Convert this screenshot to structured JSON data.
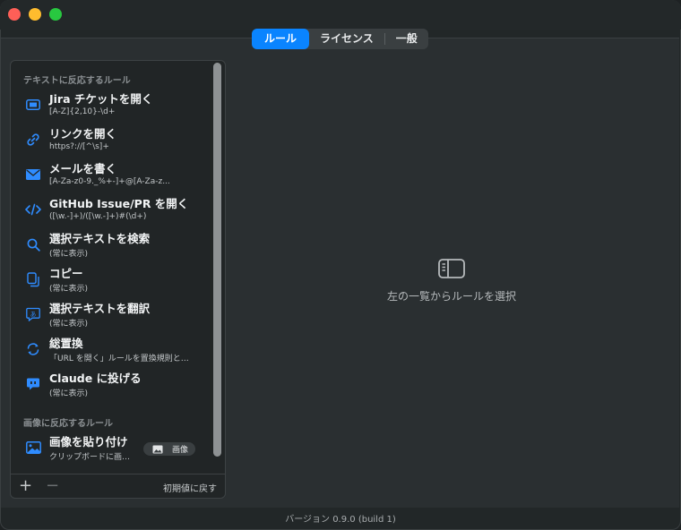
{
  "window": {
    "traffic_lights": [
      "close",
      "minimize",
      "maximize"
    ]
  },
  "tabs": [
    {
      "label": "ルール",
      "active": true
    },
    {
      "label": "ライセンス",
      "active": false
    },
    {
      "label": "一般",
      "active": false
    }
  ],
  "sidebar": {
    "text_section_header": "テキストに反応するルール",
    "image_section_header": "画像に反応するルール",
    "text_rules": [
      {
        "title": "Jira チケットを開く",
        "subtitle": "[A-Z]{2,10}-\\d+",
        "icon": "ticket-icon"
      },
      {
        "title": "リンクを開く",
        "subtitle": "https?://[^\\s]+",
        "icon": "link-icon"
      },
      {
        "title": "メールを書く",
        "subtitle": "[A-Za-z0-9._%+-]+@[A-Za-z...",
        "icon": "envelope-icon"
      },
      {
        "title": "GitHub Issue/PR を開く",
        "subtitle": "([\\w.-]+)/([\\w.-]+)#(\\d+)",
        "icon": "code-icon"
      },
      {
        "title": "選択テキストを検索",
        "subtitle": "(常に表示)",
        "icon": "magnifier-icon"
      },
      {
        "title": "コピー",
        "subtitle": "(常に表示)",
        "icon": "copy-icon"
      },
      {
        "title": "選択テキストを翻訳",
        "subtitle": "(常に表示)",
        "icon": "translate-icon"
      },
      {
        "title": "総置換",
        "subtitle": "「URL を開く」ルールを置換規則と…",
        "icon": "refresh-icon"
      },
      {
        "title": "Claude に投げる",
        "subtitle": "(常に表示)",
        "icon": "chat-bubble-icon"
      }
    ],
    "image_rules": [
      {
        "title": "画像を貼り付け",
        "subtitle": "クリップボードに画…",
        "badge": "画像",
        "icon": "photo-icon"
      }
    ],
    "footer": {
      "add": "+",
      "remove": "−",
      "reset": "初期値に戻す"
    }
  },
  "detail": {
    "empty_text": "左の一覧からルールを選択",
    "icon": "sidebar-panel-icon"
  },
  "status": {
    "version": "バージョン 0.9.0 (build 1)"
  },
  "colors": {
    "accent": "#0a84ff",
    "background": "#2a2f31",
    "sidebar_bg": "#212526"
  }
}
